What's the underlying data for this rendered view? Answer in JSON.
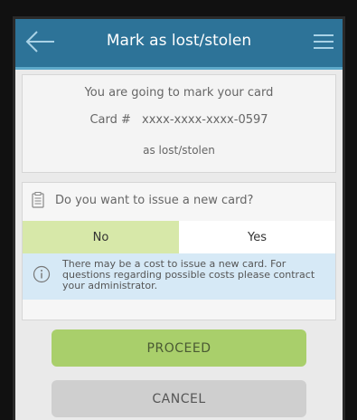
{
  "header": {
    "title": "Mark as lost/stolen"
  },
  "info": {
    "line1": "You are going to mark your card",
    "card_label": "Card #",
    "card_number": "xxxx-xxxx-xxxx-0597",
    "line3": "as lost/stolen"
  },
  "question": {
    "text": "Do you want to issue a new card?",
    "options": [
      {
        "label": "No",
        "selected": true
      },
      {
        "label": "Yes",
        "selected": false
      }
    ]
  },
  "notice": {
    "text": "There may be a cost to issue a new card. For questions regarding possible costs please contract your administrator."
  },
  "buttons": {
    "proceed": "PROCEED",
    "cancel": "CANCEL"
  },
  "colors": {
    "header": "#2d7398",
    "selected_option": "#d7e8a9",
    "notice_bg": "#d6e9f6",
    "proceed": "#a9cf6b",
    "cancel": "#cfcfcf"
  },
  "icons": {
    "back": "back-arrow-icon",
    "menu": "hamburger-menu-icon",
    "question": "clipboard-icon",
    "notice": "info-icon"
  }
}
